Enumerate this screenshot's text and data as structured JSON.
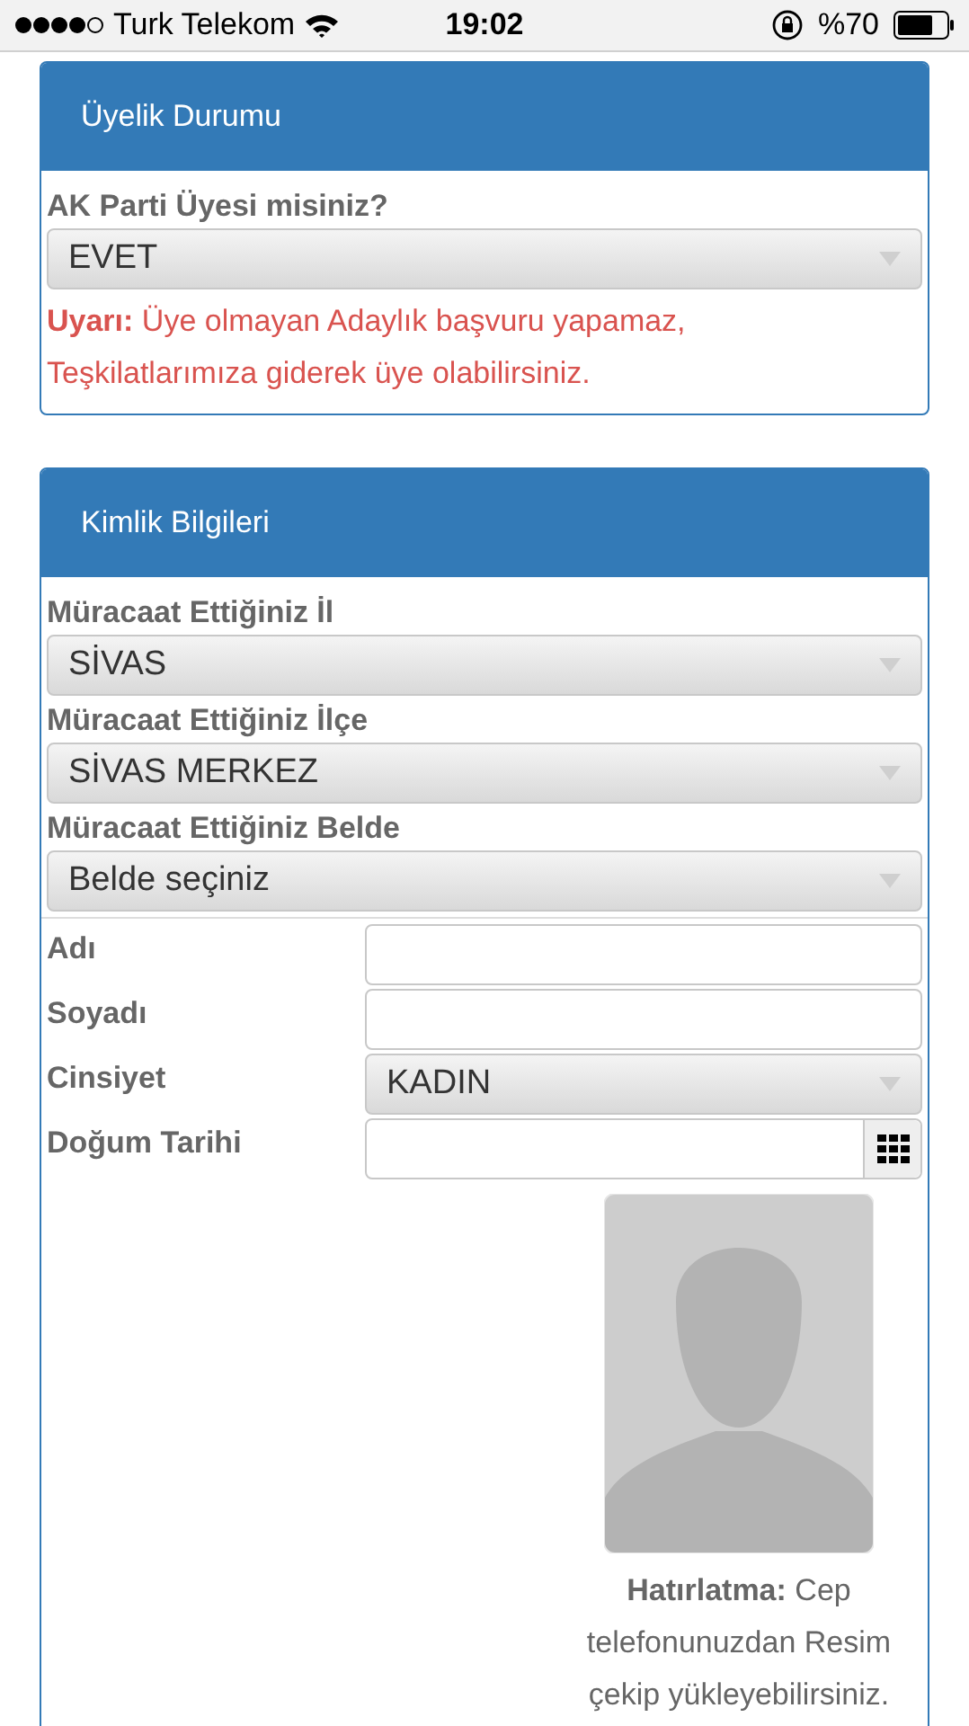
{
  "status_bar": {
    "carrier": "Turk Telekom",
    "time": "19:02",
    "battery": "%70"
  },
  "panels": [
    {
      "title": "Üyelik Durumu",
      "fields": [
        {
          "kind": "dropdown",
          "label": "AK Parti Üyesi misiniz?",
          "value": "EVET"
        },
        {
          "kind": "warning",
          "text": "**Uyarı:** Üye olmayan Adaylık başvuru yapamaz, Teşkilatlarımıza giderek üye olabilirsiniz."
        }
      ]
    },
    {
      "title": "Kimlik Bilgileri",
      "fields": [
        {
          "kind": "dropdown",
          "label": "Müracaat Ettiğiniz İl",
          "value": "SİVAS"
        },
        {
          "kind": "dropdown",
          "label": "Müracaat Ettiğiniz İlçe",
          "value": "SİVAS MERKEZ"
        },
        {
          "kind": "dropdown",
          "label": "Müracaat Ettiğiniz Belde",
          "value": "Belde seçiniz"
        },
        {
          "kind": "divider"
        },
        {
          "kind": "text",
          "label": "Adı"
        },
        {
          "kind": "text",
          "label": "Soyadı"
        },
        {
          "kind": "select",
          "label": "Cinsiyet",
          "value": "KADIN"
        },
        {
          "kind": "date",
          "label": "Doğum Tarihi"
        },
        {
          "kind": "photo",
          "hint": "**Hatırlatma:** Cep telefonunuzdan Resim çekip yükleyebilirsiniz."
        }
      ]
    }
  ]
}
